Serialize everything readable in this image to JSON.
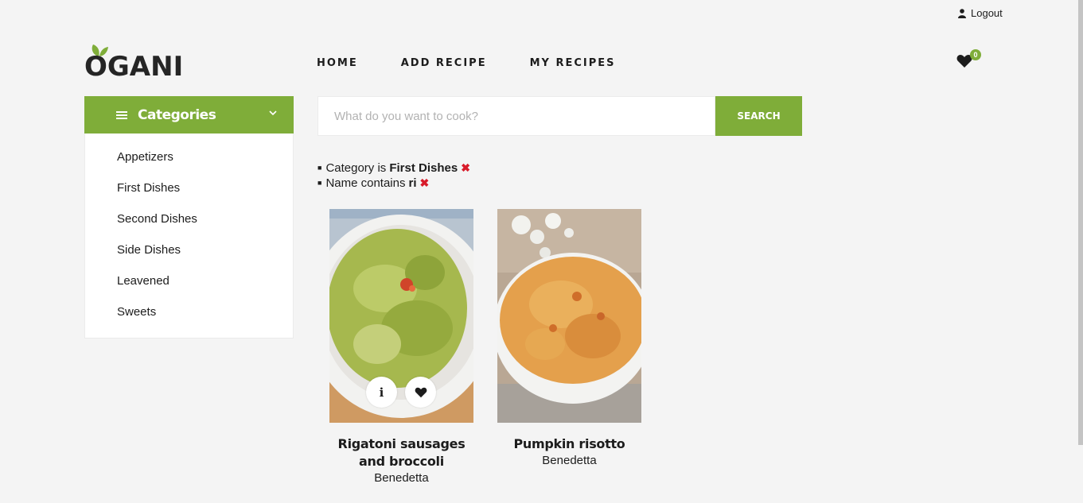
{
  "header": {
    "logout_label": "Logout",
    "logo_text": "OGANI",
    "nav": [
      "HOME",
      "ADD RECIPE",
      "MY RECIPES"
    ],
    "cart_count": "0"
  },
  "sidebar": {
    "title": "Categories",
    "items": [
      "Appetizers",
      "First Dishes",
      "Second Dishes",
      "Side Dishes",
      "Leavened",
      "Sweets"
    ]
  },
  "search": {
    "placeholder": "What do you want to cook?",
    "button_label": "SEARCH"
  },
  "filters": [
    {
      "prefix": "Category is",
      "value": "First Dishes"
    },
    {
      "prefix": "Name contains",
      "value": "ri"
    }
  ],
  "recipes": [
    {
      "name": "Rigatoni sausages and broccoli",
      "author": "Benedetta"
    },
    {
      "name": "Pumpkin risotto",
      "author": "Benedetta"
    }
  ],
  "colors": {
    "accent": "#7fad39",
    "remove": "#d81b2a",
    "background": "#f4f4f4"
  },
  "icons": {
    "user": "user-icon",
    "heart": "heart-icon",
    "info": "info-icon",
    "menu": "hamburger-icon",
    "chevron": "chevron-down-icon",
    "remove": "close-icon"
  }
}
